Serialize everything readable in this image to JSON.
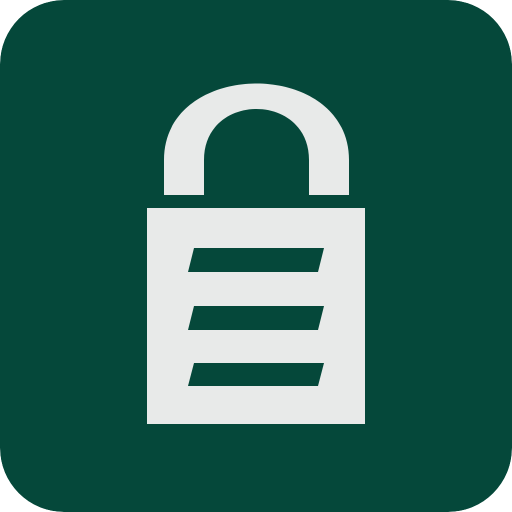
{
  "app_icon": {
    "icon": "padlock-icon",
    "colors": {
      "background": "#05483A",
      "lock": "#E8EAE9"
    }
  }
}
